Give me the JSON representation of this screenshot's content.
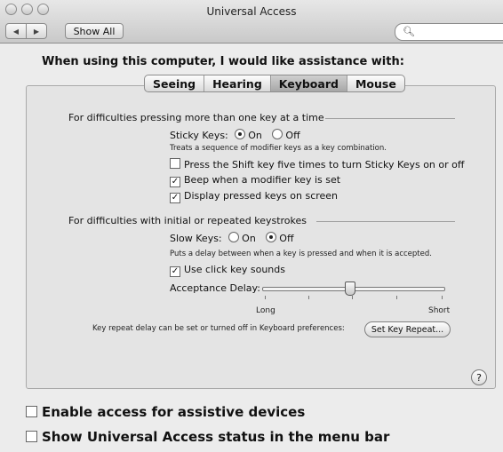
{
  "window": {
    "title": "Universal Access"
  },
  "toolbar": {
    "back_label": "◀",
    "forward_label": "▶",
    "show_all_label": "Show All",
    "search_value": ""
  },
  "heading": "When using this computer, I would like assistance with:",
  "tabs": [
    {
      "label": "Seeing",
      "selected": false
    },
    {
      "label": "Hearing",
      "selected": false
    },
    {
      "label": "Keyboard",
      "selected": true
    },
    {
      "label": "Mouse",
      "selected": false
    }
  ],
  "sticky": {
    "section_title": "For difficulties pressing more than one key at a time",
    "label": "Sticky Keys:",
    "on": "On",
    "off": "Off",
    "state": "On",
    "desc": "Treats a sequence of modifier keys as a key combination.",
    "opt_shift": "Press the Shift key five times to turn Sticky Keys on or off",
    "opt_beep": "Beep when a modifier key is set",
    "opt_display": "Display pressed keys on screen"
  },
  "slow": {
    "section_title": "For difficulties with initial or repeated keystrokes",
    "label": "Slow Keys:",
    "on": "On",
    "off": "Off",
    "state": "Off",
    "desc": "Puts a delay between when a key is pressed and when it is accepted.",
    "opt_click": "Use click key sounds",
    "delay_label": "Acceptance Delay:",
    "long": "Long",
    "short": "Short",
    "delay_value": 0.47
  },
  "repeat": {
    "text": "Key repeat delay can be set or turned off in Keyboard preferences:",
    "button": "Set Key Repeat..."
  },
  "help_label": "?",
  "bottom": {
    "assistive": "Enable access for assistive devices",
    "status": "Show Universal Access status in the menu bar"
  }
}
